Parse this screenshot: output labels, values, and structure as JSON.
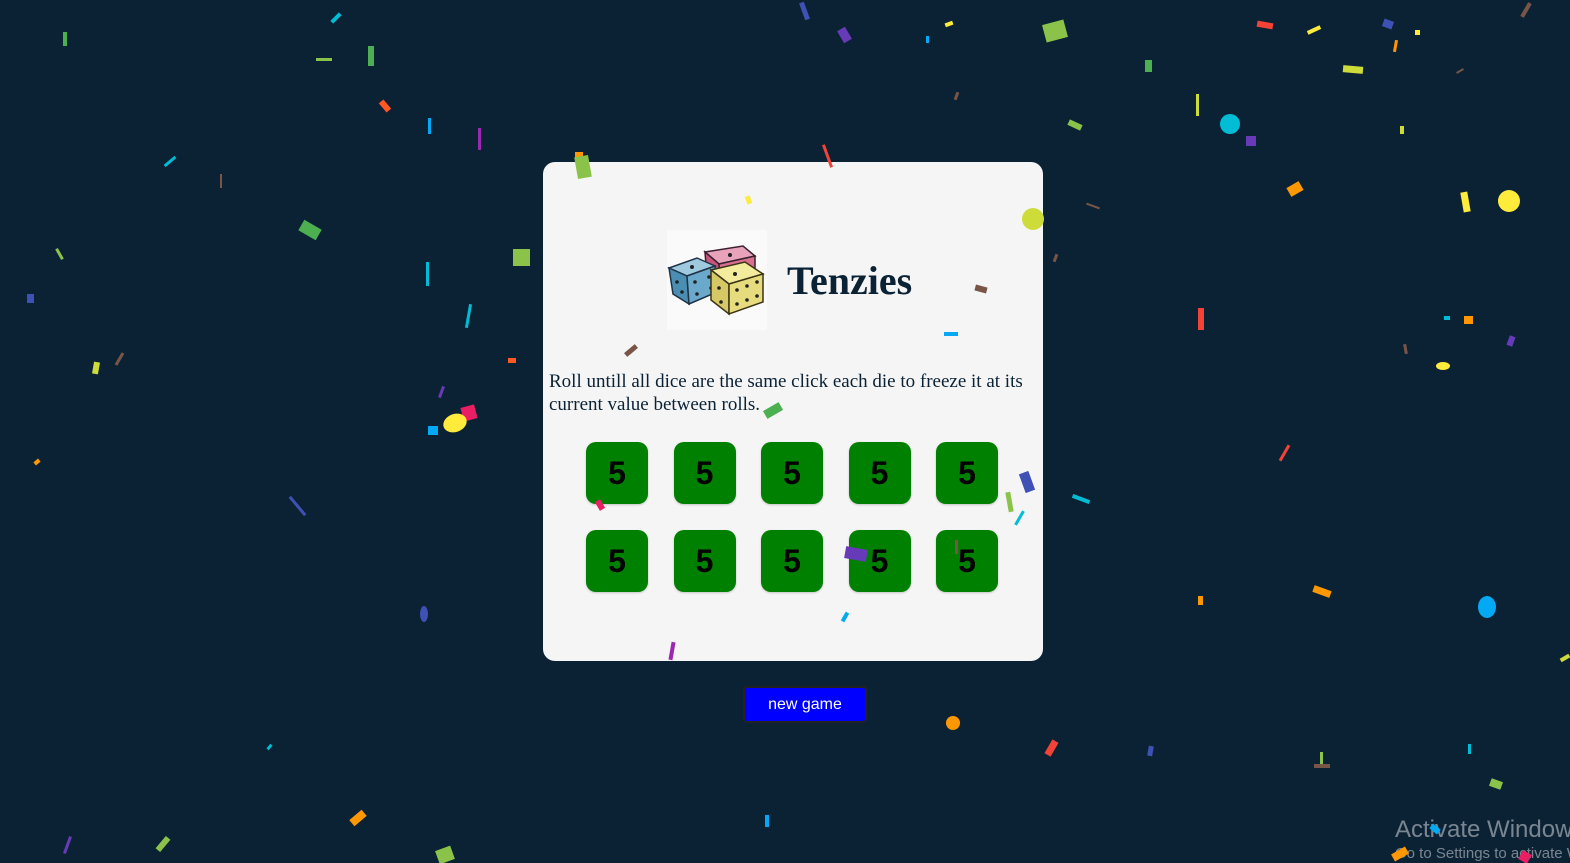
{
  "page": {
    "background_color": "#0b2235"
  },
  "header": {
    "logo_icon": "three-dice-icon",
    "title": "Tenzies"
  },
  "instructions": "Roll untill all dice are the same click each die to freeze it at its current value between rolls.",
  "dice": [
    {
      "value": "5",
      "held": true
    },
    {
      "value": "5",
      "held": true
    },
    {
      "value": "5",
      "held": true
    },
    {
      "value": "5",
      "held": true
    },
    {
      "value": "5",
      "held": true
    },
    {
      "value": "5",
      "held": true
    },
    {
      "value": "5",
      "held": true
    },
    {
      "value": "5",
      "held": true
    },
    {
      "value": "5",
      "held": true
    },
    {
      "value": "5",
      "held": true
    }
  ],
  "held_color": "#008000",
  "new_game_button": {
    "label": "new game",
    "color": "#0000ff"
  },
  "os_watermark": {
    "title": "Activate Windows",
    "subtitle": "Go to Settings to activate Windows."
  },
  "confetti_colors": [
    "#4caf50",
    "#8bc34a",
    "#cddc39",
    "#ffeb3b",
    "#ff9800",
    "#ff5722",
    "#f44336",
    "#e91e63",
    "#673ab7",
    "#3f51b5",
    "#03a9f4",
    "#00bcd4",
    "#795548",
    "#9c27b0"
  ]
}
